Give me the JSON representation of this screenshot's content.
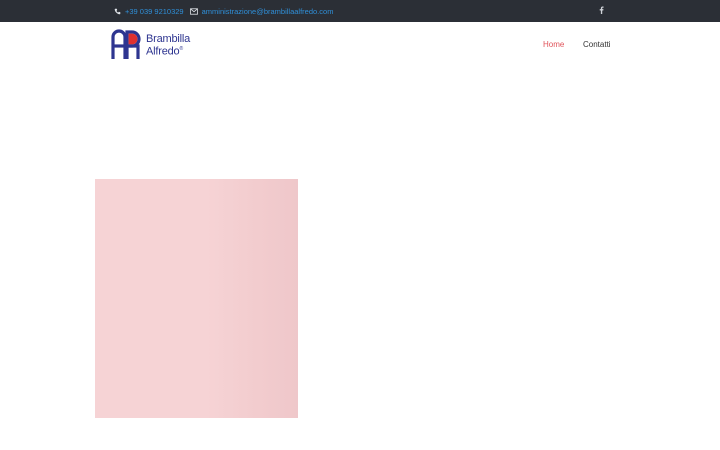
{
  "topbar": {
    "phone": "+39 039 9210329",
    "email": "amministrazione@brambillaalfredo.com",
    "social_icon": "facebook-icon"
  },
  "logo": {
    "line1": "Brambilla",
    "line2": "Alfredo",
    "registered": "®"
  },
  "nav": {
    "home": "Home",
    "contatti": "Contatti"
  },
  "colors": {
    "topbar_bg": "#2b2f36",
    "link_blue": "#2f8fd8",
    "nav_active": "#e0535a",
    "brand_blue": "#2e3590",
    "brand_red": "#e0312f",
    "banner_pink": "#f6d3d5"
  }
}
